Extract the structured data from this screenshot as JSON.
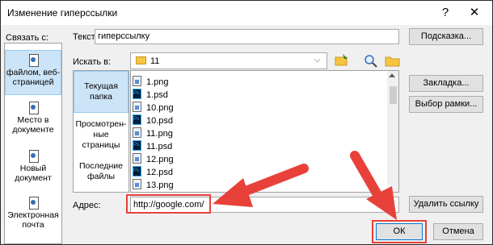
{
  "window": {
    "title": "Изменение гиперссылки",
    "help_glyph": "?",
    "close_glyph": "✕"
  },
  "link_to": {
    "label": "Связать с:",
    "items": [
      {
        "label": "файлом, веб-страницей",
        "selected": true,
        "icon": "file-web-page-icon"
      },
      {
        "label": "Место в документе",
        "selected": false,
        "icon": "place-in-document-icon"
      },
      {
        "label": "Новый документ",
        "selected": false,
        "icon": "new-document-icon"
      },
      {
        "label": "Электронная почта",
        "selected": false,
        "icon": "email-icon"
      }
    ]
  },
  "text_field": {
    "label": "Текст:",
    "value": "гиперссылку"
  },
  "tooltip_button": {
    "label": "Подсказка..."
  },
  "look_in": {
    "label": "Искать в:",
    "value": "11",
    "folder_icon": "folder-icon"
  },
  "side_nav": [
    {
      "label": "Текущая папка",
      "selected": true
    },
    {
      "label": "Просмотрен-ные страницы",
      "selected": false
    },
    {
      "label": "Последние файлы",
      "selected": false
    }
  ],
  "files": [
    {
      "name": "1.png",
      "type": "png"
    },
    {
      "name": "1.psd",
      "type": "psd"
    },
    {
      "name": "10.png",
      "type": "png"
    },
    {
      "name": "10.psd",
      "type": "psd"
    },
    {
      "name": "11.png",
      "type": "png"
    },
    {
      "name": "11.psd",
      "type": "psd"
    },
    {
      "name": "12.png",
      "type": "png"
    },
    {
      "name": "12.psd",
      "type": "psd"
    },
    {
      "name": "13.png",
      "type": "png"
    }
  ],
  "bookmark_button": {
    "label": "Закладка..."
  },
  "frame_button": {
    "label": "Выбор рамки..."
  },
  "address": {
    "label": "Адрес:",
    "value": "http://google.com/"
  },
  "remove_link_button": {
    "label": "Удалить ссылку"
  },
  "ok_button": {
    "label": "ОК"
  },
  "cancel_button": {
    "label": "Отмена"
  },
  "colors": {
    "annotation_red": "#e8413a",
    "selection_blue": "#cce4f7"
  }
}
